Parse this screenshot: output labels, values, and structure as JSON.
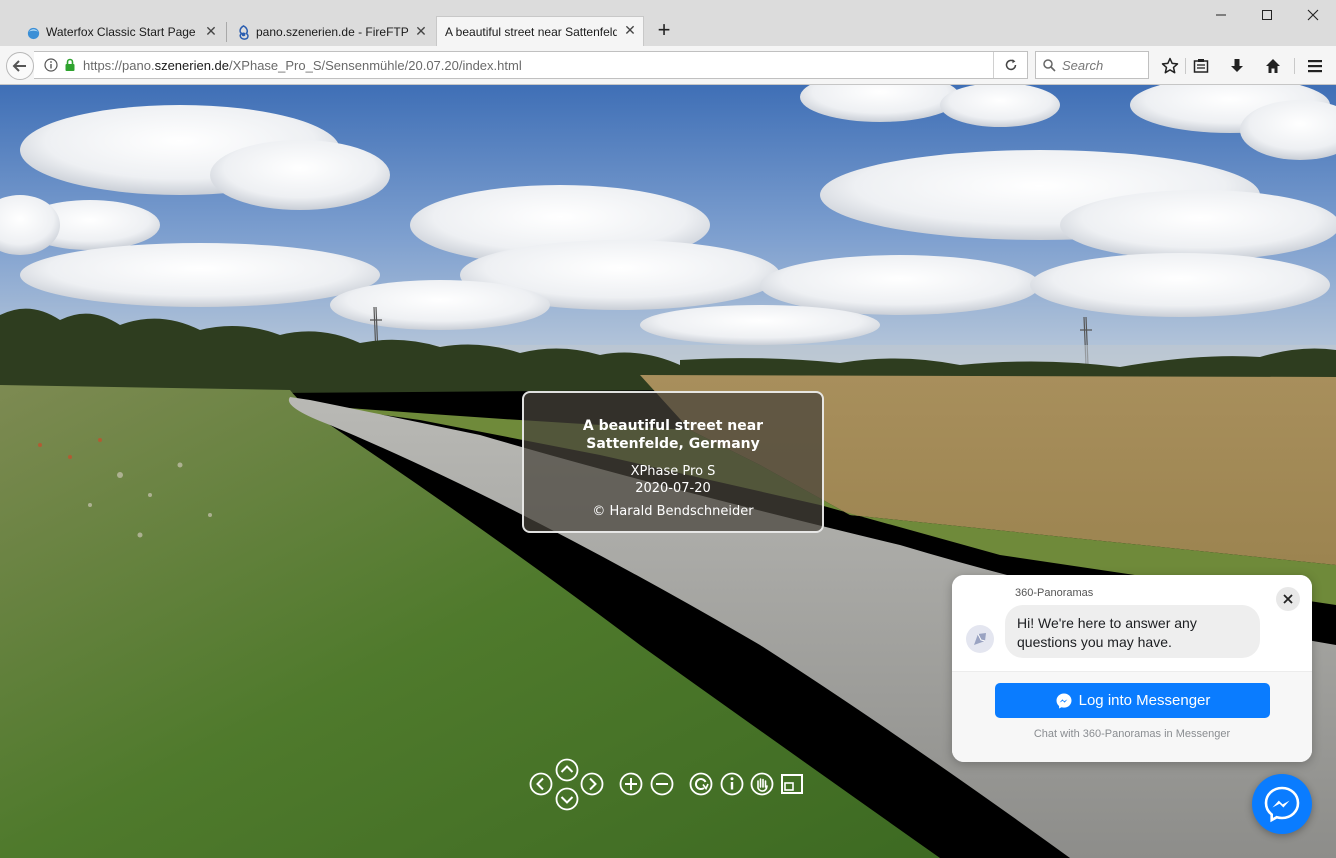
{
  "browser": {
    "tabs": [
      {
        "label": "Waterfox Classic Start Page",
        "close": "✕"
      },
      {
        "label": "pano.szenerien.de - FireFTP",
        "close": "✕"
      },
      {
        "label": "A beautiful street near Sattenfelde",
        "close": "✕"
      }
    ],
    "new_tab": "+",
    "window_controls": {
      "minimize": "—",
      "maximize": "☐",
      "close": "✕"
    },
    "url": {
      "prefix": "https://pano.",
      "domain": "szenerien.de",
      "path": "/XPhase_Pro_S/Sensenmühle/20.07.20/index.html"
    },
    "search": {
      "placeholder": "Search"
    },
    "toolbar_icons": [
      "star-icon",
      "reading-list-icon",
      "download-icon",
      "home-icon",
      "menu-icon"
    ]
  },
  "pano": {
    "title_line1": "A beautiful street near",
    "title_line2": "Sattenfelde, Germany",
    "camera": "XPhase Pro S",
    "date": "2020-07-20",
    "copyright": "© Harald Bendschneider",
    "controls": [
      "left",
      "up",
      "down",
      "right",
      "zoom-in",
      "zoom-out",
      "autorotate",
      "info",
      "hand",
      "fullscreen"
    ]
  },
  "messenger": {
    "page_name": "360-Panoramas",
    "greeting": "Hi! We're here to answer any questions you may have.",
    "close": "✕",
    "login_button": "Log into Messenger",
    "subtext": "Chat with 360-Panoramas in Messenger"
  },
  "colors": {
    "messenger_blue": "#0a7cff",
    "chrome_bg": "#dcdcdc",
    "toolbar_bg": "#f5f5f5"
  }
}
